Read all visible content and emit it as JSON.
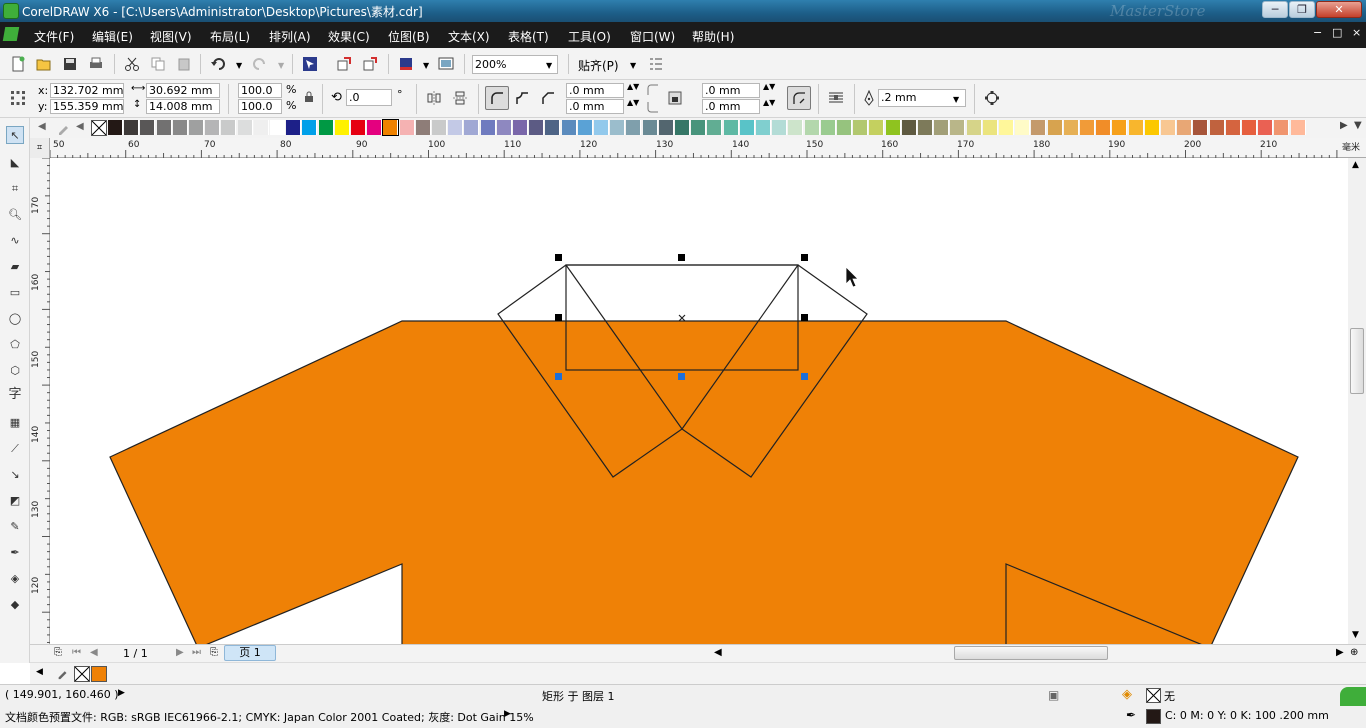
{
  "window": {
    "title": "CorelDRAW X6 - [C:\\Users\\Administrator\\Desktop\\Pictures\\素材.cdr]",
    "watermark": "MasterStore",
    "min_label": "─",
    "max_label": "❐",
    "close_label": "✕"
  },
  "menu": {
    "items": [
      "文件(F)",
      "编辑(E)",
      "视图(V)",
      "布局(L)",
      "排列(A)",
      "效果(C)",
      "位图(B)",
      "文本(X)",
      "表格(T)",
      "工具(O)",
      "窗口(W)",
      "帮助(H)"
    ],
    "mdi_min": "−",
    "mdi_restore": "□",
    "mdi_close": "×"
  },
  "toolbar": {
    "zoom_value": "200%",
    "snap_label": "贴齐(P)"
  },
  "property_bar": {
    "x_label": "x:",
    "y_label": "y:",
    "x_value": "132.702 mm",
    "y_value": "155.359 mm",
    "width_value": "30.692 mm",
    "height_value": "14.008 mm",
    "scale_w": "100.0",
    "scale_h": "100.0",
    "percent": "%",
    "rotation_value": ".0",
    "degree": "°",
    "corner_tl": ".0 mm",
    "corner_bl": ".0 mm",
    "corner_tr": ".0 mm",
    "corner_br": ".0 mm",
    "outline_width": ".2 mm"
  },
  "palette_colors": [
    "#231815",
    "#3e3a39",
    "#595757",
    "#727171",
    "#898989",
    "#9fa0a0",
    "#b5b5b6",
    "#c9caca",
    "#dcdddd",
    "#efefef",
    "#ffffff",
    "#1d2088",
    "#00a0e9",
    "#009944",
    "#fff100",
    "#e60012",
    "#e4007f",
    "#ef8200",
    "#f5b2b2",
    "#8e7d78",
    "#c9caca",
    "#c3c9e6",
    "#a0a8d4",
    "#6f7bbf",
    "#8e88c0",
    "#7a67aa",
    "#5c5b84",
    "#4e6486",
    "#5b8bbd",
    "#5aa2d6",
    "#92c9ec",
    "#9bbdcc",
    "#7f9fac",
    "#6a8a95",
    "#53666f",
    "#367767",
    "#48947c",
    "#61ad93",
    "#5eb9a4",
    "#59c3c8",
    "#80cfcf",
    "#b3dcd6",
    "#cde4cb",
    "#b3d7ac",
    "#9acb90",
    "#96c37e",
    "#b2c86f",
    "#c4d05f",
    "#8fc31f",
    "#5f5a41",
    "#7d7a5a",
    "#a29f78",
    "#b9b689",
    "#d6d489",
    "#ebe47e",
    "#fff79a",
    "#fffbc7",
    "#c49a6c",
    "#d7a34f",
    "#e6b055",
    "#f19b38",
    "#f18d28",
    "#f6a01a",
    "#f8b62d",
    "#fcc800",
    "#f8c792",
    "#e8a775",
    "#a7553a",
    "#c0623e",
    "#d5643f",
    "#e65f3e",
    "#ea6153",
    "#f0956f",
    "#ffb99a"
  ],
  "ruler": {
    "top_ticks": [
      "50",
      "60",
      "70",
      "80",
      "90",
      "100",
      "110",
      "120",
      "130",
      "140",
      "150",
      "160",
      "170",
      "180",
      "190",
      "200",
      "210"
    ],
    "top_unit": "毫米",
    "left_ticks": [
      "170",
      "160",
      "150",
      "140",
      "130",
      "120"
    ]
  },
  "page_nav": {
    "page_count": "1 / 1",
    "page_tab": "页 1"
  },
  "status": {
    "cursor_pos": "( 149.901, 160.460 )",
    "selection_info": "矩形 于 图层 1",
    "fill_label": "无",
    "color_profile": "文档颜色预置文件: RGB: sRGB IEC61966-2.1; CMYK: Japan Color 2001 Coated; 灰度: Dot Gain 15%",
    "outline_info": "C: 0 M: 0 Y: 0 K: 100  .200 mm"
  },
  "colors": {
    "shirt": "#ef8106",
    "selection_handle": "#000000",
    "node_handle": "#1e6fd9",
    "current_fill": "#ef8106"
  }
}
